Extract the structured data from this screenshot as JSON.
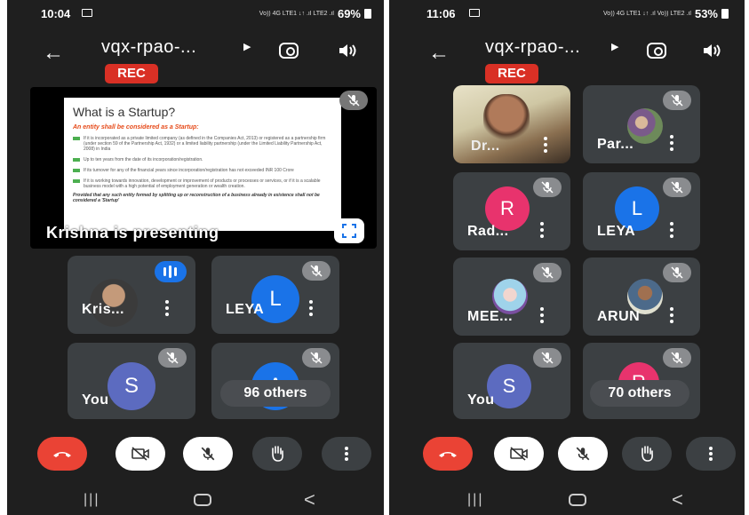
{
  "left": {
    "status": {
      "time": "10:04",
      "network": "Vo)) 4G LTE1 ↓↑ .ıl LTE2 .ıl",
      "battery": "69%"
    },
    "meeting_title": "vqx-rpao-...",
    "rec_label": "REC",
    "presentation": {
      "slide_title": "What is a Startup?",
      "slide_subtitle": "An entity shall be considered as a Startup:",
      "slide_points": [
        "If it is incorporated as a private limited company (as defined in the Companies Act, 2013) or registered as a partnership firm (under section 59 of the Partnership Act, 1932) or a limited liability partnership (under the Limited Liability Partnership Act, 2008) in India",
        "Up to ten years from the date of its incorporation/registration.",
        "If its turnover for any of the financial years since incorporation/registration has not exceeded INR 100 Crore",
        "If it is working towards innovation, development or improvement of products or processes or services, or if it is a scalable business model with a high potential of employment generation or wealth creation."
      ],
      "slide_footer": "Provided that any such entity formed by splitting up or reconstruction of a business already in existence shall not be considered a 'Startup'",
      "presenting_label": "Krishna is presenting"
    },
    "tiles": [
      {
        "name": "Kris...",
        "kind": "photo"
      },
      {
        "name": "LEYA",
        "kind": "initial",
        "initial": "L",
        "color": "#1a73e8"
      },
      {
        "name": "You",
        "kind": "initial",
        "initial": "S",
        "color": "#5c6bc0"
      },
      {
        "name": "",
        "kind": "others",
        "initial": "A",
        "color": "#1a73e8",
        "others_label": "96 others"
      }
    ]
  },
  "right": {
    "status": {
      "time": "11:06",
      "network": "Vo)) 4G LTE1 ↓↑ .ıl Vo)) LTE2 .ıl",
      "battery": "53%"
    },
    "meeting_title": "vqx-rpao-...",
    "rec_label": "REC",
    "tiles": [
      {
        "name": "Dr...",
        "kind": "video"
      },
      {
        "name": "Par...",
        "kind": "photo"
      },
      {
        "name": "Rad...",
        "kind": "initial",
        "initial": "R",
        "color": "#e8336d"
      },
      {
        "name": "LEYA",
        "kind": "initial",
        "initial": "L",
        "color": "#1a73e8"
      },
      {
        "name": "MEE...",
        "kind": "photo"
      },
      {
        "name": "ARUN",
        "kind": "photo"
      },
      {
        "name": "You",
        "kind": "initial",
        "initial": "S",
        "color": "#5c6bc0"
      },
      {
        "name": "",
        "kind": "others",
        "initial": "R",
        "color": "#e8336d",
        "others_label": "70 others"
      }
    ]
  },
  "icons": {
    "end_call": "phone-hangup-icon",
    "camera_off": "video-off-icon",
    "mic_off": "mic-off-icon",
    "raise_hand": "hand-icon",
    "more": "more-vert-icon"
  },
  "colors": {
    "background": "#1f1f1f",
    "tile": "#3c4043",
    "end_call": "#ea4335",
    "rec": "#d93025",
    "accent": "#1a73e8"
  }
}
